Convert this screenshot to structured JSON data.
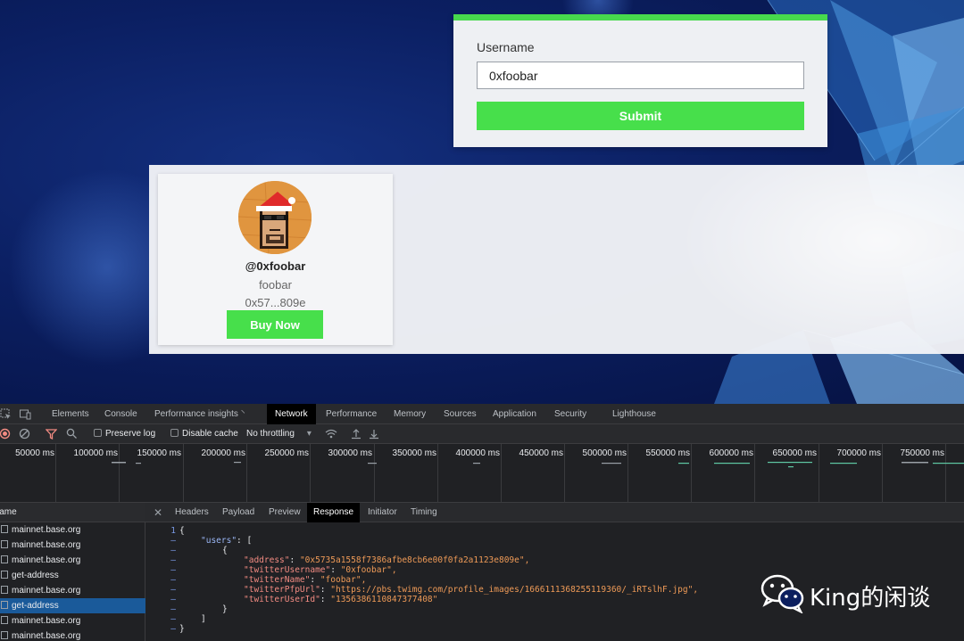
{
  "form": {
    "username_label": "Username",
    "username_value": "0xfoobar",
    "submit_label": "Submit"
  },
  "user_card": {
    "handle": "@0xfoobar",
    "name": "foobar",
    "address_short": "0x57...809e",
    "buy_label": "Buy Now"
  },
  "colors": {
    "accent_green": "#47df4b",
    "devtools_bg": "#202124",
    "selected_row": "#1a5a9a"
  },
  "devtools": {
    "icons": [
      "inspect-icon",
      "device-icon"
    ],
    "tabs": [
      {
        "label": "Elements"
      },
      {
        "label": "Console"
      },
      {
        "label": "Performance insights ⸌"
      },
      {
        "label": "Network"
      },
      {
        "label": "Performance"
      },
      {
        "label": "Memory"
      },
      {
        "label": "Sources"
      },
      {
        "label": "Application"
      },
      {
        "label": "Security"
      },
      {
        "label": "Lighthouse"
      }
    ],
    "active_tab": "Network",
    "toolbar": {
      "preserve_log": "Preserve log",
      "disable_cache": "Disable cache",
      "throttling": "No throttling"
    },
    "timeline_ticks": [
      "50000 ms",
      "100000 ms",
      "150000 ms",
      "200000 ms",
      "250000 ms",
      "300000 ms",
      "350000 ms",
      "400000 ms",
      "450000 ms",
      "500000 ms",
      "550000 ms",
      "600000 ms",
      "650000 ms",
      "700000 ms",
      "750000 ms"
    ],
    "name_header": "Name",
    "requests": [
      {
        "name": "mainnet.base.org"
      },
      {
        "name": "mainnet.base.org"
      },
      {
        "name": "mainnet.base.org"
      },
      {
        "name": "get-address"
      },
      {
        "name": "mainnet.base.org"
      },
      {
        "name": "get-address"
      },
      {
        "name": "mainnet.base.org"
      },
      {
        "name": "mainnet.base.org"
      }
    ],
    "selected_request": 5,
    "detail_tabs": [
      {
        "label": "Headers"
      },
      {
        "label": "Payload"
      },
      {
        "label": "Preview"
      },
      {
        "label": "Response"
      },
      {
        "label": "Initiator"
      },
      {
        "label": "Timing"
      }
    ],
    "active_detail_tab": "Response",
    "response": {
      "line1": "{",
      "users_key": "\"users\"",
      "users_open": ": [",
      "obj_open": "{",
      "fields": [
        {
          "key": "\"address\"",
          "value": "\"0x5735a1558f7386afbe8cb6e00f0fa2a1123e809e\","
        },
        {
          "key": "\"twitterUsername\"",
          "value": "\"0xfoobar\","
        },
        {
          "key": "\"twitterName\"",
          "value": "\"foobar\","
        },
        {
          "key": "\"twitterPfpUrl\"",
          "value": "\"https://pbs.twimg.com/profile_images/1666111368255119360/_iRTslhF.jpg\","
        },
        {
          "key": "\"twitterUserId\"",
          "value": "\"1356386110847377408\""
        }
      ],
      "obj_close": "}",
      "arr_close": "]",
      "line_end": "}",
      "line_number_1": "1",
      "dash": "–"
    }
  },
  "watermark": {
    "text": "King的闲谈",
    "logo": "wechat-icon"
  }
}
